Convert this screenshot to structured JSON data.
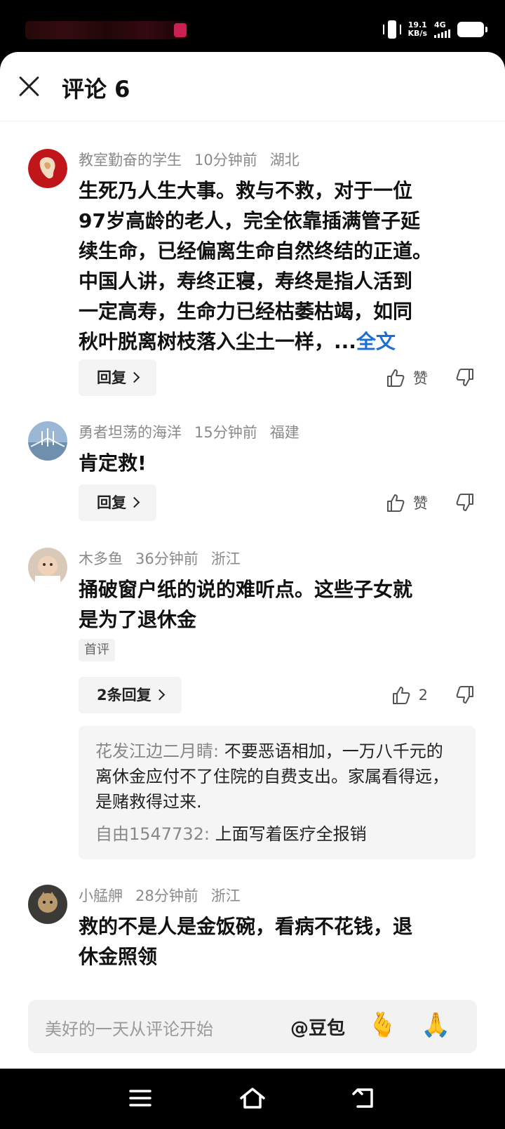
{
  "status_bar": {
    "speed_value": "19.1",
    "speed_unit": "KB/s",
    "network": "4G"
  },
  "header": {
    "title": "评论 6",
    "close_icon": "close-icon"
  },
  "comments": [
    {
      "user": "教室勤奋的学生",
      "time": "10分钟前",
      "location": "湖北",
      "text_lines": [
        "生死乃人生大事。救与不救，对于一位",
        "97岁高龄的老人，完全依靠插满管子延",
        "续生命，已经偏离生命自然终结的正道。",
        "中国人讲，寿终正寝，寿终是指人活到",
        "一定高寿，生命力已经枯萎枯竭，如同",
        "秋叶脱离树枝落入尘土一样，..."
      ],
      "more_label": "全文",
      "reply_label": "回复",
      "like_label": "赞"
    },
    {
      "user": "勇者坦荡的海洋",
      "time": "15分钟前",
      "location": "福建",
      "text": "肯定救!",
      "reply_label": "回复",
      "like_label": "赞"
    },
    {
      "user": "木多鱼",
      "time": "36分钟前",
      "location": "浙江",
      "text_lines": [
        "捅破窗户纸的说的难听点。这些子女就",
        "是为了退休金"
      ],
      "tag": "首评",
      "reply_label": "2条回复",
      "like_count": "2",
      "sub_replies": [
        {
          "user": "花发江边二月睛",
          "text": "不要恶语相加，一万八千元的离休金应付不了住院的自费支出。家属看得远，是赌救得过来."
        },
        {
          "user": "自由1547732",
          "text": "上面写着医疗全报销"
        }
      ]
    },
    {
      "user": "小艋舺",
      "time": "28分钟前",
      "location": "浙江",
      "text_lines": [
        "救的不是人是金饭碗，看病不花钱，退",
        "休金照领"
      ]
    }
  ],
  "input_bar": {
    "placeholder": "美好的一天从评论开始",
    "mention": "@豆包",
    "emoji_1": "🫰",
    "emoji_2": "🙏"
  },
  "nav_bar": {
    "icons": [
      "menu-icon",
      "home-icon",
      "back-icon"
    ]
  }
}
